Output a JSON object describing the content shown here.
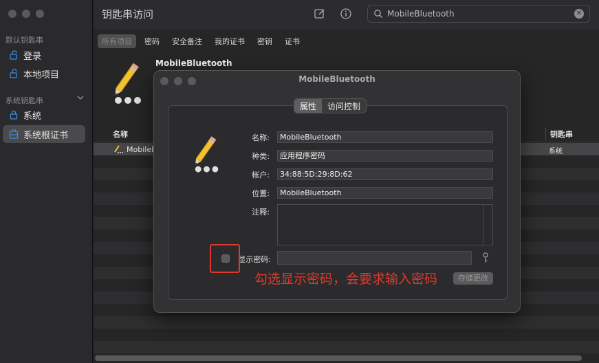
{
  "sidebar": {
    "default_section": "默认钥匙串",
    "default_items": [
      {
        "label": "登录"
      },
      {
        "label": "本地项目"
      }
    ],
    "system_section": "系统钥匙串",
    "system_items": [
      {
        "label": "系统"
      },
      {
        "label": "系统根证书"
      }
    ]
  },
  "window": {
    "title": "钥匙串访问",
    "search_query": "MobileBluetooth"
  },
  "tabs": [
    {
      "label": "所有项目"
    },
    {
      "label": "密码"
    },
    {
      "label": "安全备注"
    },
    {
      "label": "我的证书"
    },
    {
      "label": "密钥"
    },
    {
      "label": "证书"
    }
  ],
  "detail_header": {
    "name": "MobileBluetooth"
  },
  "table": {
    "col_name": "名称",
    "col_keychain": "钥匙串",
    "rows": [
      {
        "name": "MobileBluetooth",
        "keychain": "系统"
      }
    ]
  },
  "dialog": {
    "title": "MobileBluetooth",
    "tab_attributes": "属性",
    "tab_access": "访问控制",
    "label_name": "名称:",
    "value_name": "MobileBluetooth",
    "label_kind": "种类:",
    "value_kind": "应用程序密码",
    "label_account": "帐户:",
    "value_account": "34:88:5D:29:8D:62",
    "label_where": "位置:",
    "value_where": "MobileBluetooth",
    "label_comments": "注释:",
    "show_password_label": "显示密码:",
    "save_label": "存储更改"
  },
  "annotation": {
    "text": "勾选显示密码，会要求输入密码",
    "color": "#e0382c"
  }
}
